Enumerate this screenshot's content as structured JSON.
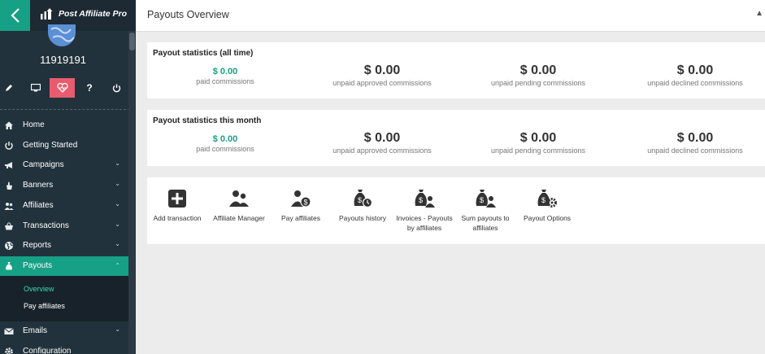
{
  "app": {
    "logo_text": "Post Affiliate Pro"
  },
  "user": {
    "name": "11919191"
  },
  "sidebar": {
    "items": [
      {
        "label": "Home",
        "icon": "home-icon",
        "chevron": false
      },
      {
        "label": "Getting Started",
        "icon": "power-icon",
        "chevron": false
      },
      {
        "label": "Campaigns",
        "icon": "megaphone-icon",
        "chevron": true
      },
      {
        "label": "Banners",
        "icon": "hand-icon",
        "chevron": true
      },
      {
        "label": "Affiliates",
        "icon": "users-icon",
        "chevron": true
      },
      {
        "label": "Transactions",
        "icon": "basket-icon",
        "chevron": true
      },
      {
        "label": "Reports",
        "icon": "globe-icon",
        "chevron": true
      },
      {
        "label": "Payouts",
        "icon": "money-bag-icon",
        "chevron": true,
        "active": true
      },
      {
        "label": "Emails",
        "icon": "envelope-icon",
        "chevron": true
      },
      {
        "label": "Configuration",
        "icon": "gear-icon",
        "chevron": false
      }
    ],
    "subitems": [
      {
        "label": "Overview",
        "active": true
      },
      {
        "label": "Pay affiliates",
        "active": false
      }
    ],
    "chevron_down": "⌄",
    "chevron_up": "⌃"
  },
  "header": {
    "title": "Payouts Overview"
  },
  "stats_all_time": {
    "title": "Payout statistics (all time)",
    "items": [
      {
        "value": "$ 0.00",
        "caption": "paid commissions"
      },
      {
        "value": "$ 0.00",
        "caption": "unpaid approved commissions"
      },
      {
        "value": "$ 0.00",
        "caption": "unpaid pending commissions"
      },
      {
        "value": "$ 0.00",
        "caption": "unpaid declined commissions"
      }
    ]
  },
  "stats_month": {
    "title": "Payout statistics this month",
    "items": [
      {
        "value": "$ 0.00",
        "caption": "paid commissions"
      },
      {
        "value": "$ 0.00",
        "caption": "unpaid approved commissions"
      },
      {
        "value": "$ 0.00",
        "caption": "unpaid pending commissions"
      },
      {
        "value": "$ 0.00",
        "caption": "unpaid declined commissions"
      }
    ]
  },
  "tools": [
    {
      "line1": "Add transaction",
      "line2": ""
    },
    {
      "line1": "Affiliate Manager",
      "line2": ""
    },
    {
      "line1": "Pay affiliates",
      "line2": ""
    },
    {
      "line1": "Payouts history",
      "line2": ""
    },
    {
      "line1": "Invoices - Payouts",
      "line2": "by affiliates"
    },
    {
      "line1": "Sum payouts to",
      "line2": "affiliates"
    },
    {
      "line1": "Payout Options",
      "line2": ""
    }
  ],
  "colors": {
    "accent": "#16a085",
    "sidebar": "#22323c",
    "highlight": "#e85c6e"
  }
}
